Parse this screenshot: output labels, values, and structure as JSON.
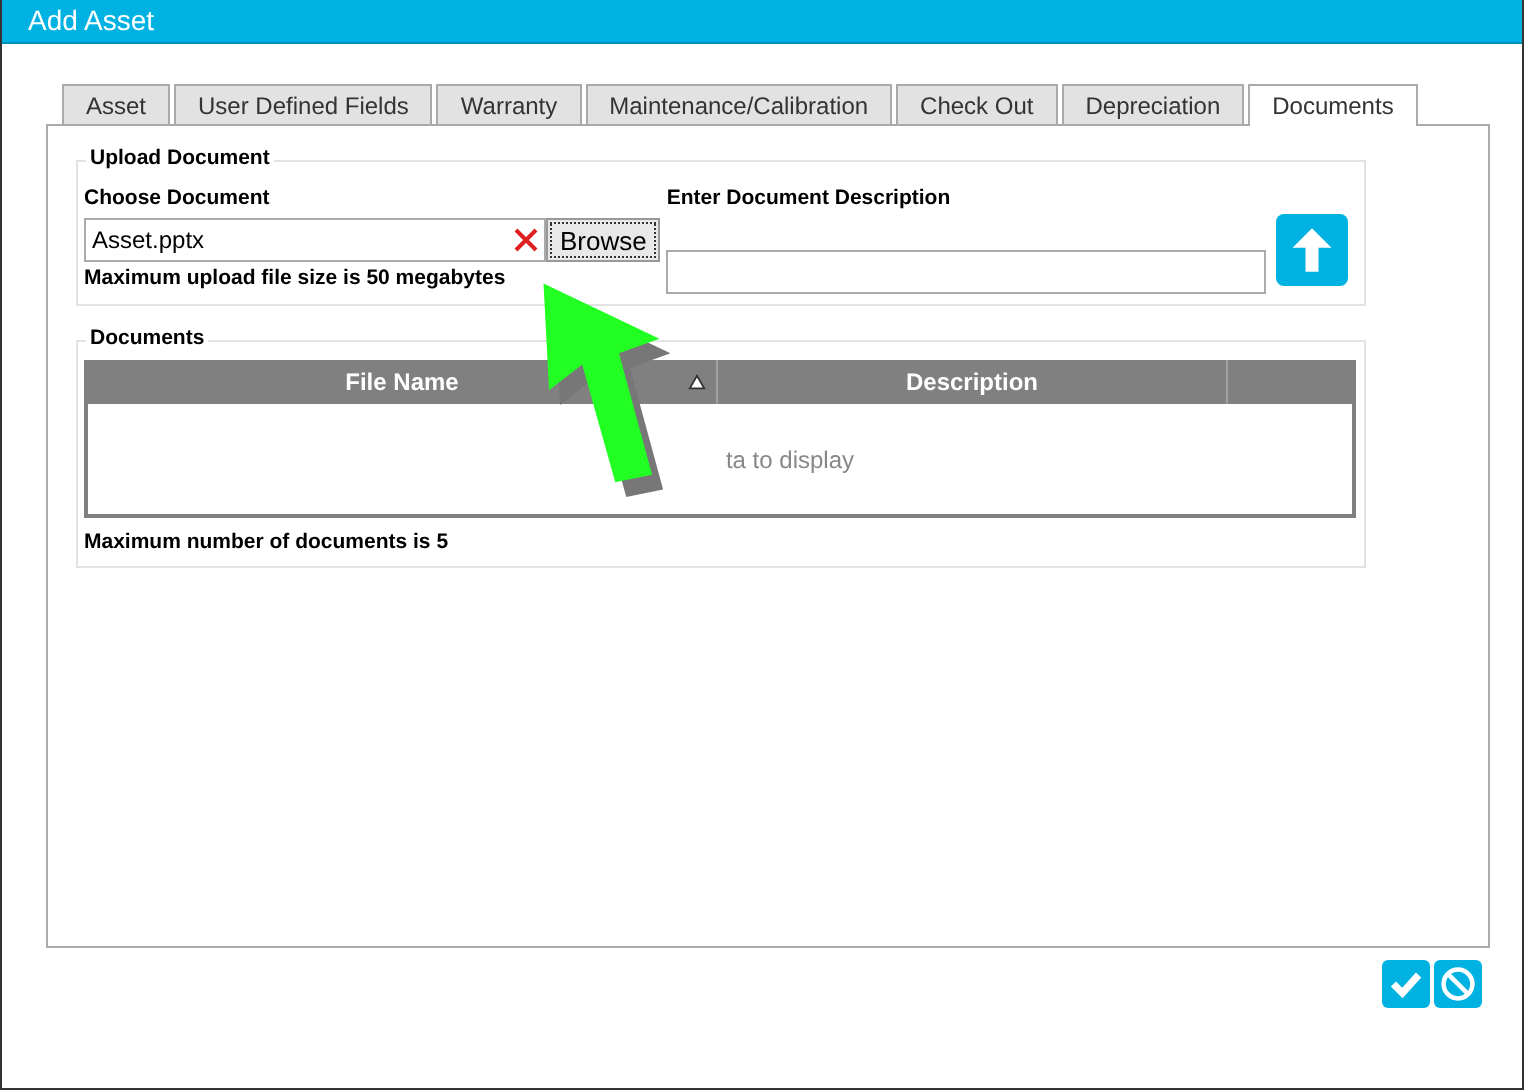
{
  "window": {
    "title": "Add Asset"
  },
  "tabs": [
    {
      "label": "Asset",
      "selected": false
    },
    {
      "label": "User Defined Fields",
      "selected": false
    },
    {
      "label": "Warranty",
      "selected": false
    },
    {
      "label": "Maintenance/Calibration",
      "selected": false
    },
    {
      "label": "Check Out",
      "selected": false
    },
    {
      "label": "Depreciation",
      "selected": false
    },
    {
      "label": "Documents",
      "selected": true
    }
  ],
  "upload": {
    "legend": "Upload Document",
    "choose_label": "Choose Document",
    "file_value": "Asset.pptx",
    "browse_button": "Browse",
    "description_label": "Enter Document Description",
    "size_note": "Maximum upload file size is 50 megabytes"
  },
  "documents": {
    "legend": "Documents",
    "columns": [
      {
        "label": "File Name",
        "sorted": true
      },
      {
        "label": "Description",
        "sorted": false
      }
    ],
    "empty_text": "ta to display",
    "count_note": "Maximum number of documents is 5"
  }
}
